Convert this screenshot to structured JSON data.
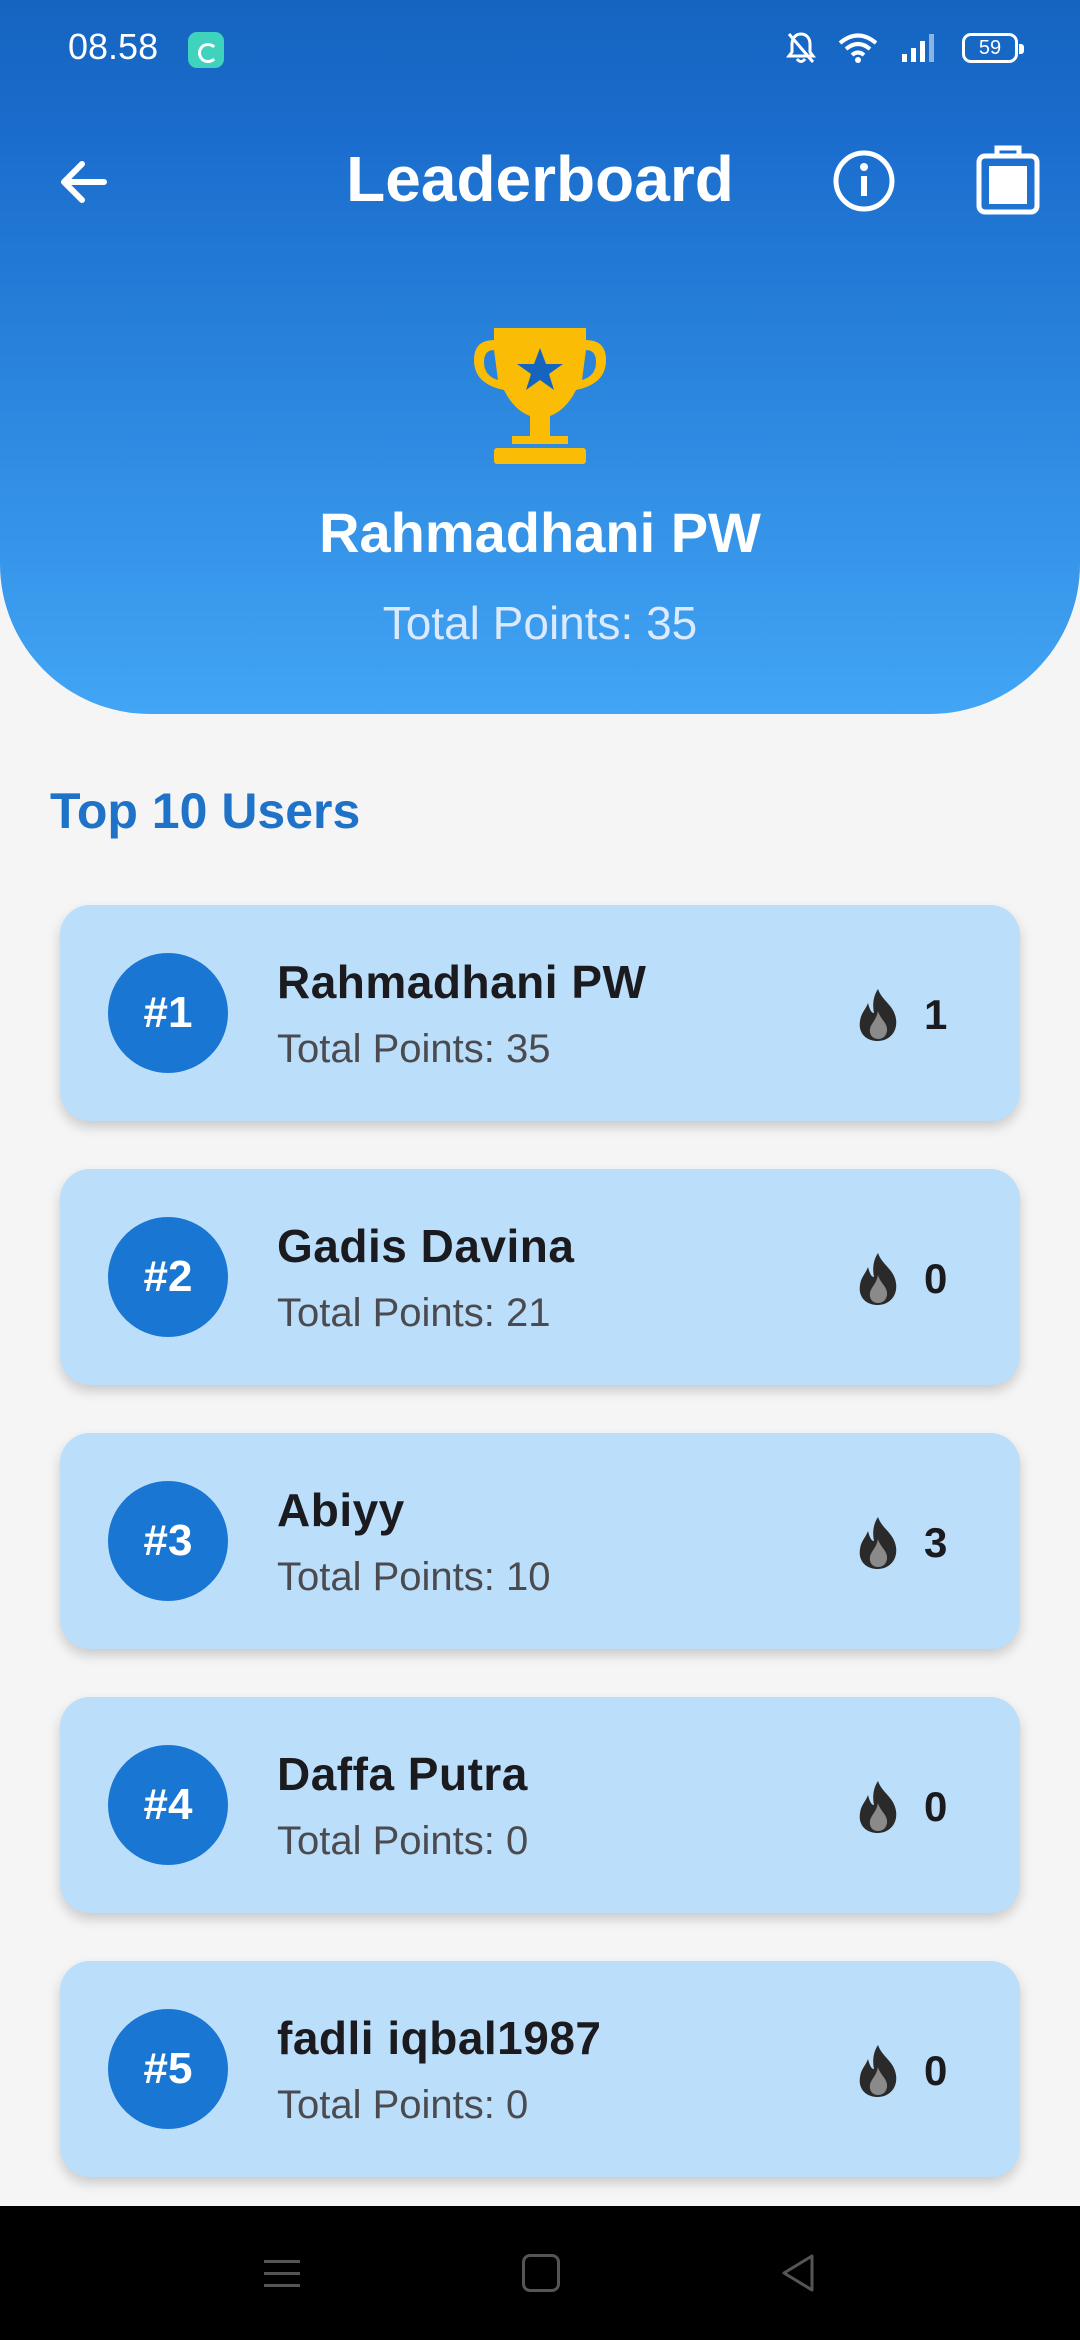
{
  "status_bar": {
    "time": "08.58",
    "battery": "59",
    "icons": [
      "notification-app-icon",
      "bell-off-icon",
      "wifi-icon",
      "signal-icon",
      "battery-icon"
    ]
  },
  "app_bar": {
    "title": "Leaderboard",
    "icons": [
      "back-arrow-icon",
      "info-icon",
      "shopping-bag-icon"
    ]
  },
  "current_user": {
    "name": "Rahmadhani PW",
    "points_label": "Total Points: 35",
    "icon": "trophy-icon"
  },
  "section_title": "Top 10 Users",
  "users": [
    {
      "rank": "#1",
      "name": "Rahmadhani PW",
      "points": "Total Points: 35",
      "streak": "1"
    },
    {
      "rank": "#2",
      "name": "Gadis Davina",
      "points": "Total Points: 21",
      "streak": "0"
    },
    {
      "rank": "#3",
      "name": "Abiyy",
      "points": "Total Points: 10",
      "streak": "3"
    },
    {
      "rank": "#4",
      "name": "Daffa Putra",
      "points": "Total Points: 0",
      "streak": "0"
    },
    {
      "rank": "#5",
      "name": "fadli iqbal1987",
      "points": "Total Points: 0",
      "streak": "0"
    }
  ],
  "colors": {
    "header_top": "#1565c0",
    "header_bottom": "#42a5f5",
    "card_bg": "#bbdefb",
    "rank_badge": "#1976d2",
    "section_title": "#1e72c8",
    "trophy": "#fbbc05"
  },
  "nav_bar": {
    "icons": [
      "menu-icon",
      "home-icon",
      "back-icon"
    ]
  }
}
